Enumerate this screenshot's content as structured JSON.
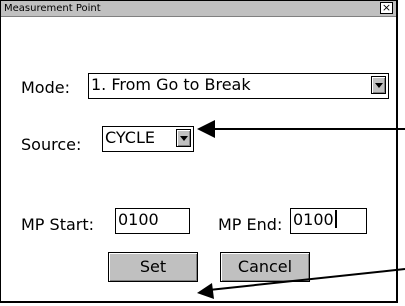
{
  "window": {
    "title": "Measurement Point",
    "close_label": "×"
  },
  "mode": {
    "label": "Mode:",
    "value": "1. From Go to Break"
  },
  "source": {
    "label": "Source:",
    "value": "CYCLE"
  },
  "mp_start": {
    "label": "MP Start:",
    "value": "0100"
  },
  "mp_end": {
    "label": "MP End:",
    "value": "0100"
  },
  "buttons": {
    "set": "Set",
    "cancel": "Cancel"
  },
  "icons": {
    "dropdown": "chevron-down-icon",
    "close": "close-icon",
    "callout": "callout-arrow-icon"
  },
  "colors": {
    "dialog_bg": "#ffffff",
    "titlebar_bg": "#c0c0c0",
    "button_bg": "#c0c0c0",
    "text": "#000000"
  }
}
